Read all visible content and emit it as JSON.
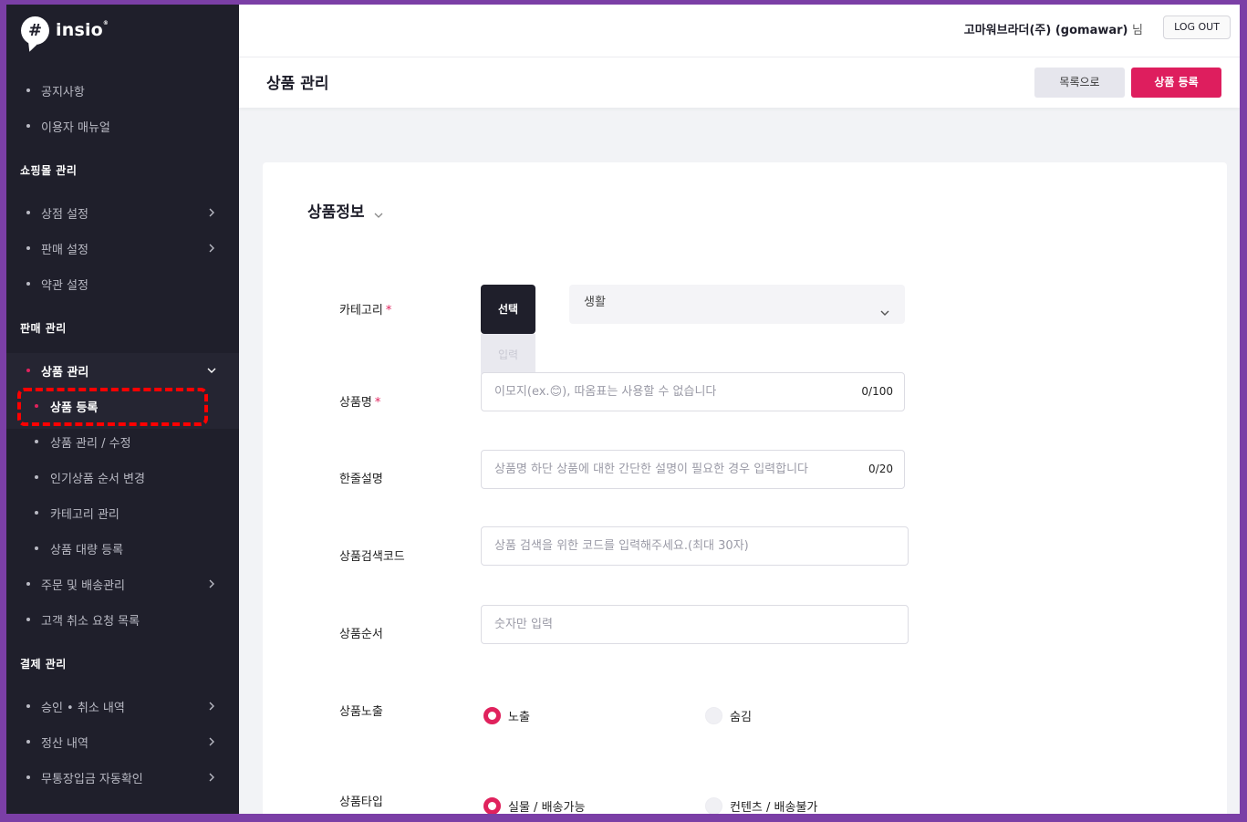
{
  "brand": {
    "name": "insio",
    "mark": "#"
  },
  "sidebar": {
    "top_items": [
      {
        "label": "공지사항"
      },
      {
        "label": "이용자 매뉴얼"
      }
    ],
    "sections": [
      {
        "title": "쇼핑몰 관리",
        "items": [
          {
            "label": "상점 설정"
          },
          {
            "label": "판매 설정"
          },
          {
            "label": "약관 설정"
          }
        ]
      },
      {
        "title": "판매 관리",
        "items": [
          {
            "label": "상품 관리"
          },
          {
            "label": "상품 등록"
          },
          {
            "label": "상품 관리 / 수정"
          },
          {
            "label": "인기상품 순서 변경"
          },
          {
            "label": "카테고리 관리"
          },
          {
            "label": "상품 대량 등록"
          },
          {
            "label": "주문 및 배송관리"
          },
          {
            "label": "고객 취소 요청 목록"
          }
        ]
      },
      {
        "title": "결제 관리",
        "items": [
          {
            "label": "승인 • 취소 내역"
          },
          {
            "label": "정산 내역"
          },
          {
            "label": "무통장입금 자동확인"
          }
        ]
      }
    ]
  },
  "header": {
    "user_name": "고마워브라더(주) (gomawar)",
    "user_suffix": "님",
    "logout_label": "LOG OUT"
  },
  "page": {
    "title": "상품 관리",
    "btn_list": "목록으로",
    "btn_register": "상품 등록"
  },
  "form": {
    "section_title": "상품정보",
    "category": {
      "label": "카테고리",
      "required": "*",
      "select_btn": "선택",
      "input_btn": "입력",
      "value": "생활"
    },
    "name": {
      "label": "상품명",
      "required": "*",
      "placeholder_pre": "이모지(ex.",
      "emoji": "😊",
      "placeholder_post": "), 따옴표는 사용할 수 없습니다",
      "count": "0/100"
    },
    "summary": {
      "label": "한줄설명",
      "placeholder": "상품명 하단 상품에 대한 간단한 설명이 필요한 경우 입력합니다",
      "count": "0/20"
    },
    "search_code": {
      "label": "상품검색코드",
      "placeholder": "상품 검색을 위한 코드를 입력해주세요.(최대 30자)"
    },
    "order": {
      "label": "상품순서",
      "placeholder": "숫자만 입력"
    },
    "exposure": {
      "label": "상품노출",
      "options": [
        "노출",
        "숨김"
      ],
      "selected": "노출"
    },
    "type": {
      "label": "상품타입",
      "options": [
        "실물 / 배송가능",
        "컨텐츠 / 배송불가"
      ],
      "selected": "실물 / 배송가능"
    }
  },
  "colors": {
    "accent": "#de1e5e",
    "sidebar_bg": "#1f1f2b",
    "highlight": "#ff0000"
  }
}
